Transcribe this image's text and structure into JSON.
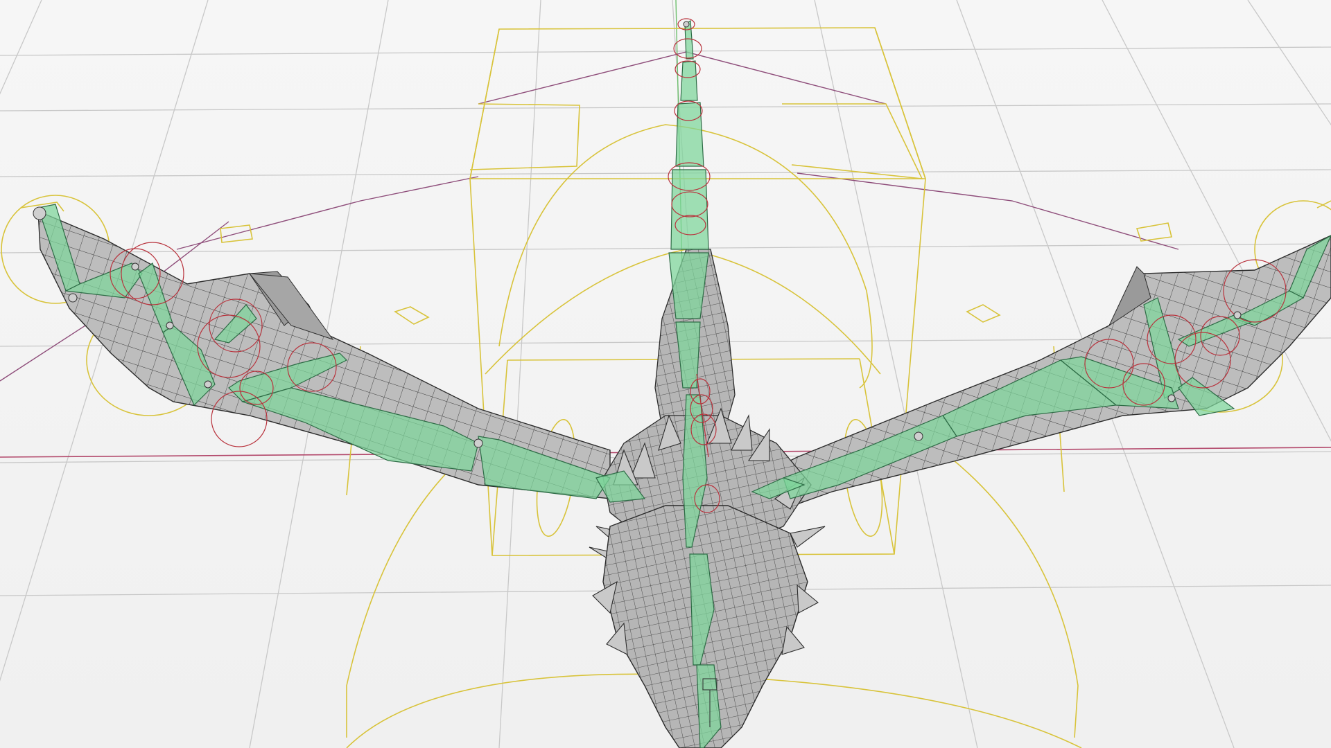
{
  "viewport": {
    "name": "3d-viewport",
    "mode": "perspective",
    "shading": "x-ray-wireframe",
    "subject": "dragon-rig",
    "overlays": [
      "grid-floor",
      "armature-bones",
      "rig-controls",
      "world-axes"
    ]
  },
  "colors": {
    "background": "#f4f4f4",
    "grid": "#c8c8c8",
    "axis_x": "#b2476a",
    "axis_y": "#6dbf6d",
    "mesh_fill": "#b9b9b9",
    "mesh_wire": "#2c2c2c",
    "bone_fill": "#7dd59a",
    "bone_edge": "#2d6b45",
    "control_yellow": "#d8c33a",
    "control_red": "#b8323c",
    "control_purple": "#8e4d7a"
  },
  "icons": [
    "bone-icon",
    "controller-icon"
  ]
}
